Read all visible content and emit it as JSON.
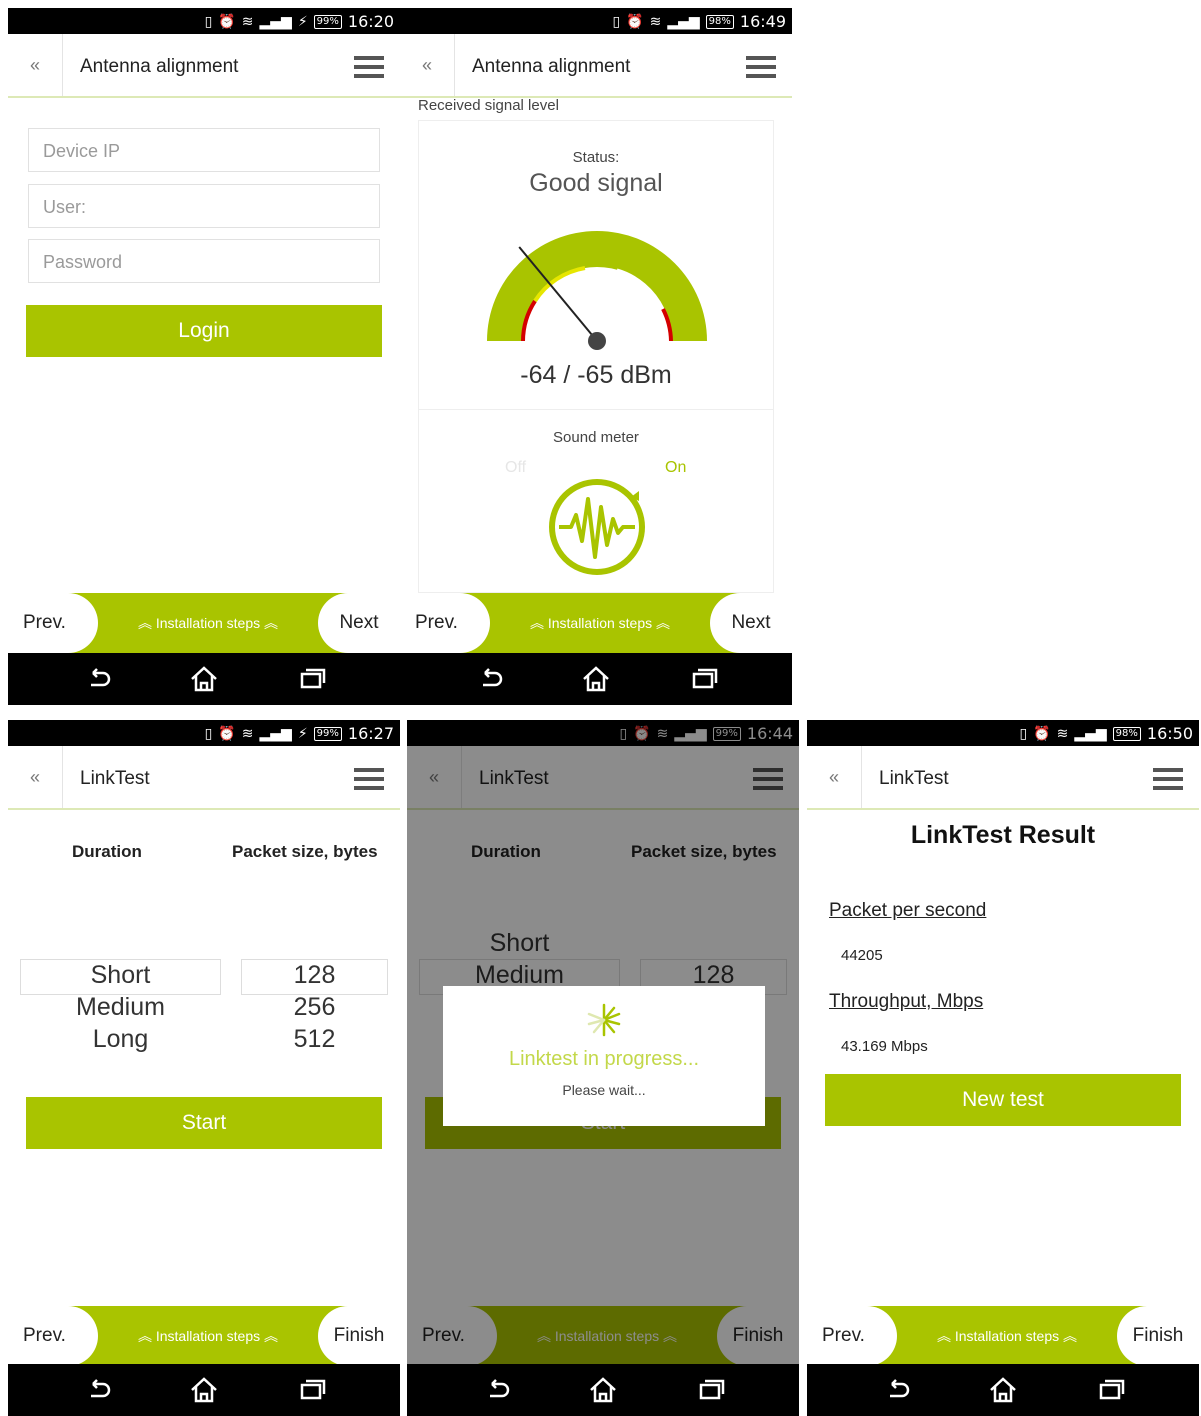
{
  "colors": {
    "accent": "#a9c400",
    "red": "#d40000",
    "yellow": "#e6e600"
  },
  "nav_icons": [
    "back-icon",
    "home-icon",
    "recents-icon"
  ],
  "screens": [
    {
      "status": {
        "battery": "99%",
        "time": "16:20"
      },
      "title": "Antenna alignment",
      "fields": {
        "ip": "Device IP",
        "user": "User:",
        "password": "Password"
      },
      "login_label": "Login",
      "bottom": {
        "prev": "Prev.",
        "steps": "Installation steps",
        "next": "Next"
      }
    },
    {
      "status": {
        "battery": "98%",
        "time": "16:49"
      },
      "title": "Antenna alignment",
      "section_label": "Received signal level",
      "status_label": "Status:",
      "status_value": "Good signal",
      "gauge": {
        "reading": "-64 / -65 dBm",
        "needle_level": 0.28
      },
      "sound_meter": {
        "label": "Sound meter",
        "off": "Off",
        "on": "On"
      },
      "bottom": {
        "prev": "Prev.",
        "steps": "Installation steps",
        "next": "Next"
      }
    },
    {
      "status": {
        "battery": "99%",
        "time": "16:27"
      },
      "title": "LinkTest",
      "duration_label": "Duration",
      "packet_label": "Packet size, bytes",
      "durations": [
        "Short",
        "Medium",
        "Long"
      ],
      "sizes": [
        "128",
        "256",
        "512"
      ],
      "start_label": "Start",
      "bottom": {
        "prev": "Prev.",
        "steps": "Installation steps",
        "next": "Finish"
      }
    },
    {
      "status": {
        "battery": "99%",
        "time": "16:44"
      },
      "title": "LinkTest",
      "duration_label": "Duration",
      "packet_label": "Packet size, bytes",
      "durations": [
        "Short",
        "Medium"
      ],
      "sizes": [
        "128"
      ],
      "start_label": "Start",
      "dialog": {
        "title": "Linktest in progress...",
        "subtitle": "Please wait..."
      },
      "bottom": {
        "prev": "Prev.",
        "steps": "Installation steps",
        "next": "Finish"
      }
    },
    {
      "status": {
        "battery": "98%",
        "time": "16:50"
      },
      "title": "LinkTest",
      "result_title": "LinkTest Result",
      "pps_label": "Packet per second",
      "pps_value": "44205",
      "tp_label": "Throughput, Mbps",
      "tp_value": "43.169 Mbps",
      "new_test_label": "New test",
      "bottom": {
        "prev": "Prev.",
        "steps": "Installation steps",
        "next": "Finish"
      }
    }
  ]
}
